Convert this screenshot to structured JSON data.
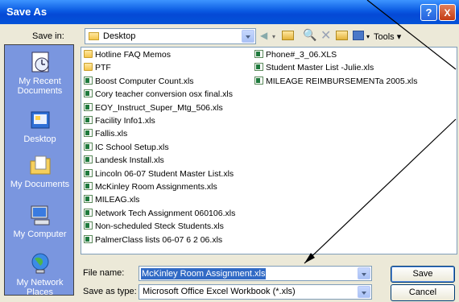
{
  "dialog": {
    "title": "Save As",
    "help_label": "?",
    "close_label": "X"
  },
  "save_in": {
    "label": "Save in:",
    "value": "Desktop",
    "tools_label": "Tools"
  },
  "places": [
    {
      "label": "My Recent Documents",
      "icon": "recent-documents-icon"
    },
    {
      "label": "Desktop",
      "icon": "desktop-icon"
    },
    {
      "label": "My Documents",
      "icon": "my-documents-icon"
    },
    {
      "label": "My Computer",
      "icon": "my-computer-icon"
    },
    {
      "label": "My Network Places",
      "icon": "network-places-icon"
    }
  ],
  "files_col1": [
    {
      "name": "Hotline FAQ Memos",
      "type": "folder"
    },
    {
      "name": "PTF",
      "type": "folder"
    },
    {
      "name": "Boost Computer Count.xls",
      "type": "xls"
    },
    {
      "name": "Cory teacher conversion osx final.xls",
      "type": "xls"
    },
    {
      "name": "EOY_Instruct_Super_Mtg_506.xls",
      "type": "xls"
    },
    {
      "name": "Facility Info1.xls",
      "type": "xls"
    },
    {
      "name": "Fallis.xls",
      "type": "xls"
    },
    {
      "name": "IC School Setup.xls",
      "type": "xls"
    },
    {
      "name": "Landesk Install.xls",
      "type": "xls"
    },
    {
      "name": "Lincoln 06-07 Student Master List.xls",
      "type": "xls"
    },
    {
      "name": "McKinley Room Assignments.xls",
      "type": "xls"
    },
    {
      "name": "MILEAG.xls",
      "type": "xls"
    },
    {
      "name": "Network Tech Assignment 060106.xls",
      "type": "xls"
    },
    {
      "name": "Non-scheduled Steck Students.xls",
      "type": "xls"
    },
    {
      "name": "PalmerClass lists 06-07 6 2 06.xls",
      "type": "xls"
    }
  ],
  "files_col2": [
    {
      "name": "Phone#_3_06.XLS",
      "type": "xls"
    },
    {
      "name": "Student Master List -Julie.xls",
      "type": "xls"
    },
    {
      "name": "MILEAGE REIMBURSEMENTa 2005.xls",
      "type": "xls"
    }
  ],
  "file_name": {
    "label": "File name:",
    "value": "McKinley Room Assignment.xls"
  },
  "save_as_type": {
    "label": "Save as type:",
    "value": "Microsoft Office Excel Workbook (*.xls)"
  },
  "buttons": {
    "save": "Save",
    "cancel": "Cancel"
  }
}
